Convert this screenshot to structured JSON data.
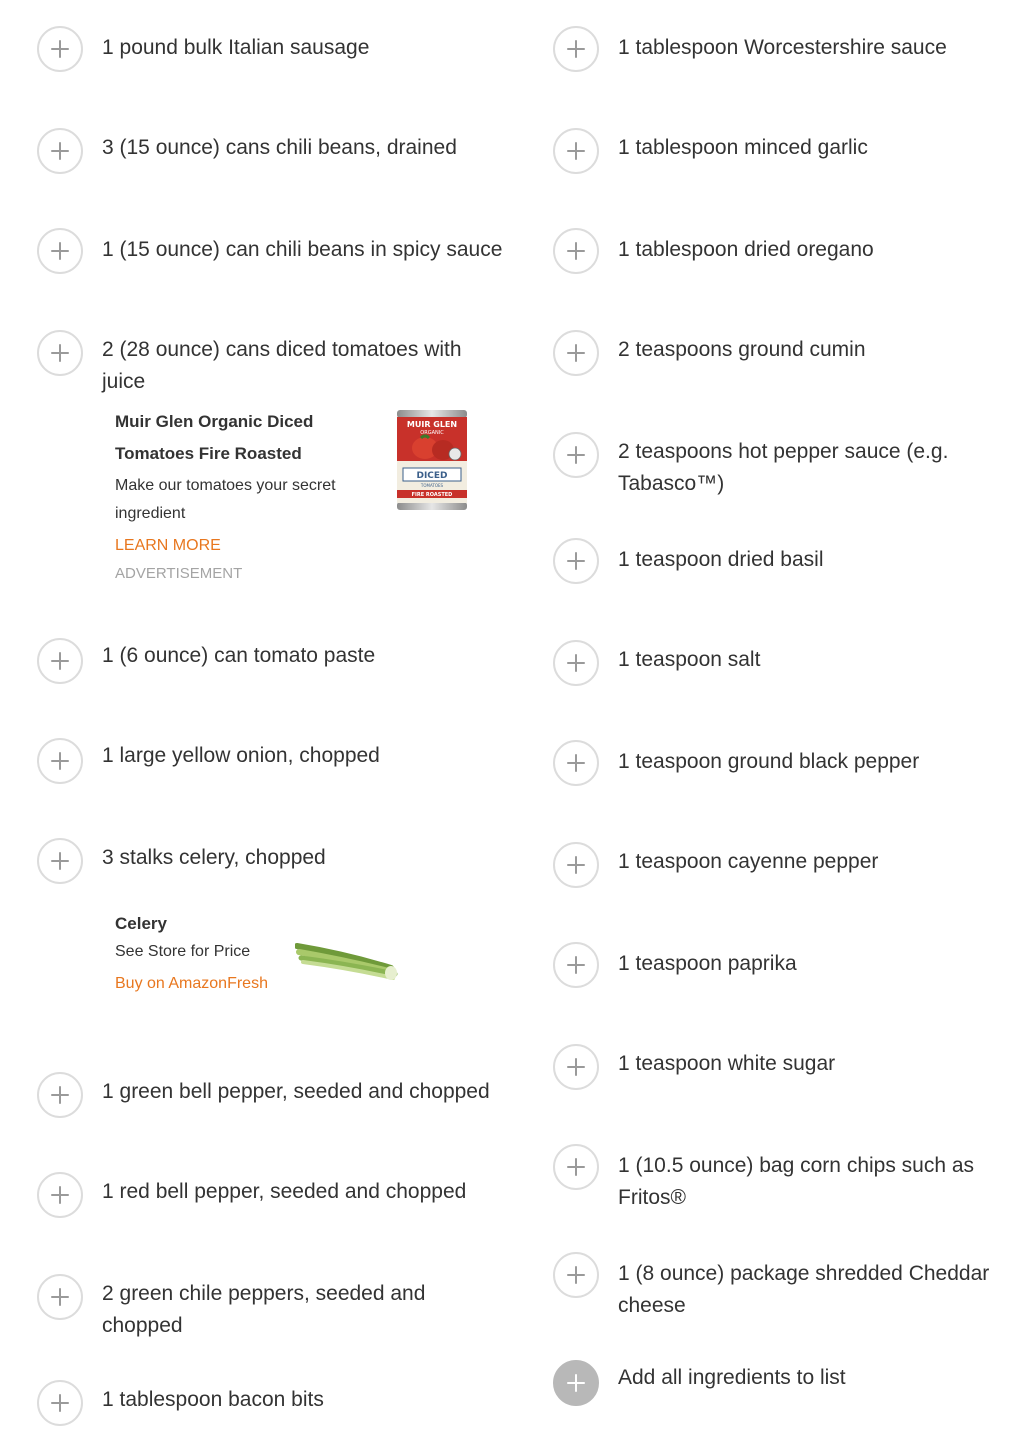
{
  "left_column": [
    {
      "label": "1 pound bulk Italian sausage"
    },
    {
      "label": "3 (15 ounce) cans chili beans, drained"
    },
    {
      "label": "1 (15 ounce) can chili beans in spicy sauce"
    },
    {
      "label": "2 (28 ounce) cans diced tomatoes with juice"
    },
    {
      "label": "1 (6 ounce) can tomato paste"
    },
    {
      "label": "1 large yellow onion, chopped"
    },
    {
      "label": "3 stalks celery, chopped"
    },
    {
      "label": "1 green bell pepper, seeded and chopped"
    },
    {
      "label": "1 red bell pepper, seeded and chopped"
    },
    {
      "label": "2 green chile peppers, seeded and chopped"
    },
    {
      "label": "1 tablespoon bacon bits"
    }
  ],
  "right_column": [
    {
      "label": "1 tablespoon Worcestershire sauce"
    },
    {
      "label": "1 tablespoon minced garlic"
    },
    {
      "label": "1 tablespoon dried oregano"
    },
    {
      "label": "2 teaspoons ground cumin"
    },
    {
      "label": "2 teaspoons hot pepper sauce (e.g. Tabasco™)"
    },
    {
      "label": "1 teaspoon dried basil"
    },
    {
      "label": "1 teaspoon salt"
    },
    {
      "label": "1 teaspoon ground black pepper"
    },
    {
      "label": "1 teaspoon cayenne pepper"
    },
    {
      "label": "1 teaspoon paprika"
    },
    {
      "label": "1 teaspoon white sugar"
    },
    {
      "label": "1 (10.5 ounce) bag corn chips such as Fritos®"
    },
    {
      "label": "1 (8 ounce) package shredded Cheddar cheese"
    }
  ],
  "add_all": {
    "label": "Add all ingredients to list"
  },
  "ad_tomatoes": {
    "title": "Muir Glen Organic Diced Tomatoes Fire Roasted",
    "description": "Make our tomatoes your secret ingredient",
    "link": "LEARN MORE",
    "ad_label": "ADVERTISEMENT",
    "product_brand": "MUIR GLEN",
    "product_organic": "ORGANIC",
    "product_name": "DICED",
    "product_sub": "TOMATOES",
    "product_band": "FIRE ROASTED"
  },
  "ad_celery": {
    "title": "Celery",
    "price": "See Store for Price",
    "link": "Buy on AmazonFresh"
  },
  "colors": {
    "text": "#333333",
    "link_orange": "#e8771f",
    "ad_label_gray": "#a4a4a4",
    "circle_border": "#dcdcdc",
    "plus_gray": "#9a9a9a",
    "add_all_bg": "#b8b8b8"
  }
}
